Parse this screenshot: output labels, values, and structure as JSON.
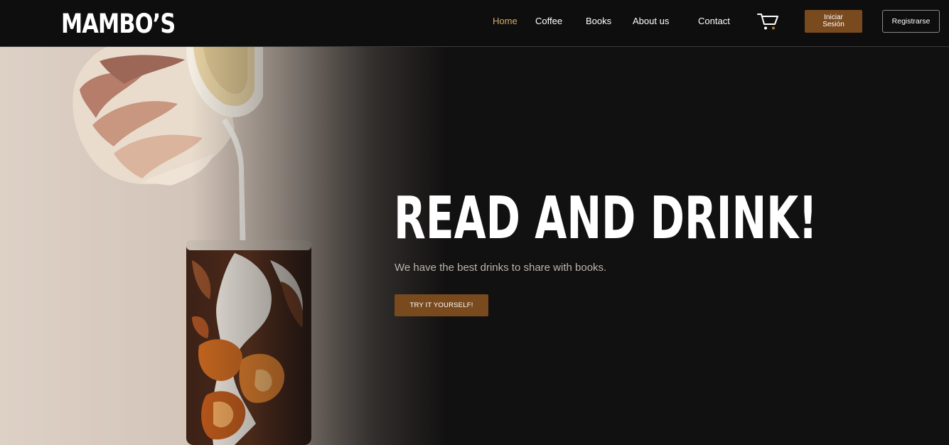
{
  "brand": {
    "logo": "MAMBO’S"
  },
  "nav": {
    "items": [
      {
        "label": "Home",
        "active": true
      },
      {
        "label": "Coffee",
        "active": false
      },
      {
        "label": "Books",
        "active": false
      },
      {
        "label": "About us",
        "active": false
      },
      {
        "label": "Contact",
        "active": false
      }
    ],
    "cart_icon": "shopping-cart-icon",
    "login_label": "Iniciar Sesión",
    "register_label": "Registrarse"
  },
  "hero": {
    "headline": "READ AND DRINK!",
    "subtitle": "We have the best drinks to share with books.",
    "cta_label": "TRY IT YOURSELF!",
    "illustration": "milk-pouring-into-iced-coffee-glass"
  },
  "colors": {
    "background": "#121111",
    "navbar": "#0e0e0e",
    "accent_brown": "#7a4a1f",
    "active_nav": "#d9a86a",
    "text": "#ffffff",
    "subtitle_text": "#b9b4ae"
  }
}
